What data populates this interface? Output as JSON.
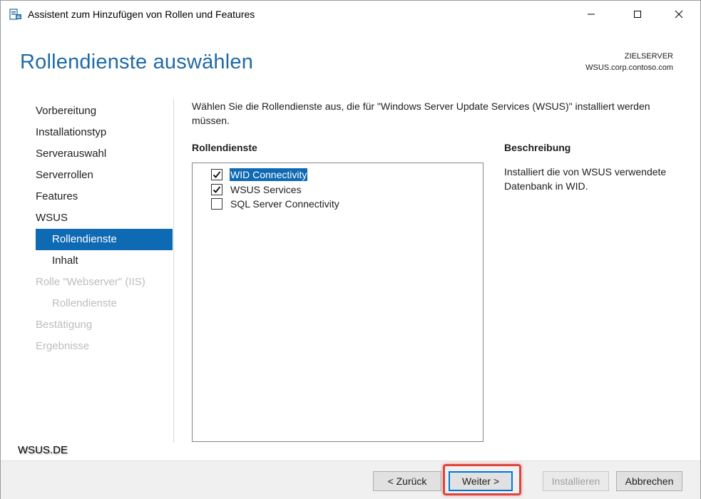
{
  "window": {
    "title": "Assistent zum Hinzufügen von Rollen und Features",
    "icon": "server-manager-icon"
  },
  "header": {
    "page_title": "Rollendienste auswählen",
    "target_label": "ZIELSERVER",
    "target_value": "WSUS.corp.contoso.com"
  },
  "nav": {
    "items": [
      {
        "label": "Vorbereitung",
        "state": "normal"
      },
      {
        "label": "Installationstyp",
        "state": "normal"
      },
      {
        "label": "Serverauswahl",
        "state": "normal"
      },
      {
        "label": "Serverrollen",
        "state": "normal"
      },
      {
        "label": "Features",
        "state": "normal"
      },
      {
        "label": "WSUS",
        "state": "normal"
      },
      {
        "label": "Rollendienste",
        "state": "active"
      },
      {
        "label": "Inhalt",
        "state": "normal"
      },
      {
        "label": "Rolle \"Webserver\" (IIS)",
        "state": "disabled"
      },
      {
        "label": "Rollendienste",
        "state": "disabled"
      },
      {
        "label": "Bestätigung",
        "state": "disabled"
      },
      {
        "label": "Ergebnisse",
        "state": "disabled"
      }
    ]
  },
  "main": {
    "intro": "Wählen Sie die Rollendienste aus, die für \"Windows Server Update Services (WSUS)\" installiert werden müssen.",
    "roles_heading": "Rollendienste",
    "description_heading": "Beschreibung",
    "roles": [
      {
        "label": "WID Connectivity",
        "checked": true,
        "selected": true
      },
      {
        "label": "WSUS Services",
        "checked": true,
        "selected": false
      },
      {
        "label": "SQL Server Connectivity",
        "checked": false,
        "selected": false
      }
    ],
    "description": "Installiert die von WSUS verwendete Datenbank in WID."
  },
  "watermark": "WSUS.DE",
  "footer": {
    "back_label": "< Zurück",
    "next_label": "Weiter >",
    "install_label": "Installieren",
    "cancel_label": "Abbrechen"
  },
  "colors": {
    "accent": "#0f6ab4",
    "title": "#1f6aa6",
    "highlight": "#e0443c"
  }
}
